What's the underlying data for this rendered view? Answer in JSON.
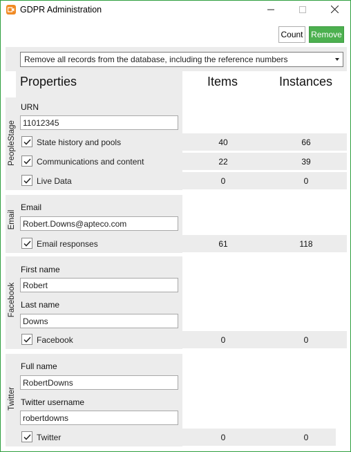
{
  "window": {
    "title": "GDPR Administration"
  },
  "toolbar": {
    "count_label": "Count",
    "remove_label": "Remove"
  },
  "colors": {
    "accent_green": "#4cb04f",
    "window_border": "#2e9e3e",
    "panel_grey": "#ececec",
    "app_icon": "#f08a24"
  },
  "icons": {
    "app": "app-icon",
    "minimize": "minimize-icon",
    "maximize": "maximize-icon",
    "close": "close-icon",
    "check": "check-icon",
    "dropdown": "chevron-down-icon"
  },
  "mode_select": {
    "value": "Remove all records from the database, including the reference numbers"
  },
  "headers": {
    "properties": "Properties",
    "items": "Items",
    "instances": "Instances"
  },
  "sections": {
    "peoplestage": {
      "label": "PeopleStage",
      "fields": [
        {
          "label": "URN",
          "value": "11012345"
        }
      ],
      "rows": [
        {
          "label": "State history and pools",
          "checked": true,
          "items": "40",
          "instances": "66"
        },
        {
          "label": "Communications and content",
          "checked": true,
          "items": "22",
          "instances": "39"
        },
        {
          "label": "Live Data",
          "checked": true,
          "items": "0",
          "instances": "0"
        }
      ]
    },
    "email": {
      "label": "Email",
      "fields": [
        {
          "label": "Email",
          "value": "Robert.Downs@apteco.com"
        }
      ],
      "rows": [
        {
          "label": "Email responses",
          "checked": true,
          "items": "61",
          "instances": "118"
        }
      ]
    },
    "facebook": {
      "label": "Facebook",
      "fields": [
        {
          "label": "First name",
          "value": "Robert"
        },
        {
          "label": "Last name",
          "value": "Downs"
        }
      ],
      "rows": [
        {
          "label": "Facebook",
          "checked": true,
          "items": "0",
          "instances": "0"
        }
      ]
    },
    "twitter": {
      "label": "Twitter",
      "fields": [
        {
          "label": "Full name",
          "value": "RobertDowns"
        },
        {
          "label": "Twitter username",
          "value": "robertdowns"
        }
      ],
      "rows": [
        {
          "label": "Twitter",
          "checked": true,
          "items": "0",
          "instances": "0"
        }
      ]
    }
  }
}
